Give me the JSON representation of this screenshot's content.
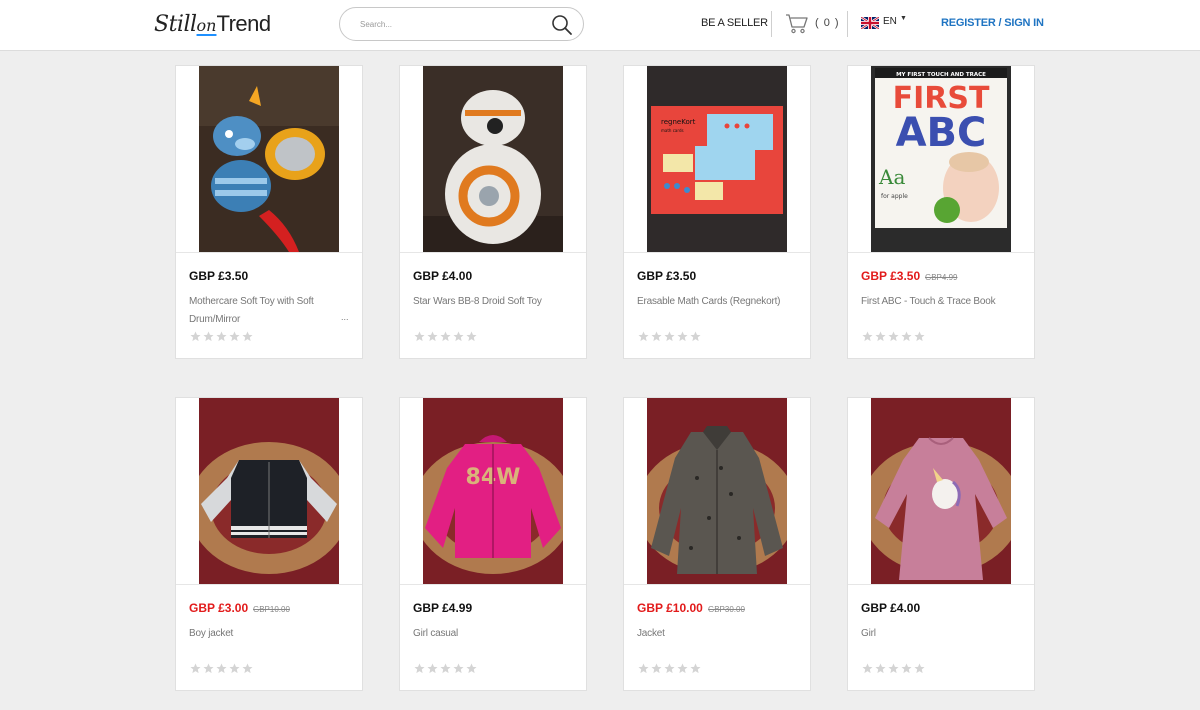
{
  "header": {
    "logo": {
      "still": "Still",
      "on": "on",
      "trend": "Trend"
    },
    "search_placeholder": "Search...",
    "seller_link": "BE A SELLER",
    "cart_count": "( 0 )",
    "language": "EN",
    "register": "REGISTER / SIGN IN"
  },
  "colors": {
    "accent": "#1f74c2",
    "sale_red": "#e21b1b",
    "page_bg": "#eeeeee"
  },
  "products": [
    {
      "price": "GBP £3.50",
      "old_price": "",
      "name": "Mothercare Soft Toy with Soft Drum/Mirror",
      "more": "...",
      "rating": 0
    },
    {
      "price": "GBP £4.00",
      "old_price": "",
      "name": "Star Wars BB-8 Droid Soft Toy",
      "more": "",
      "rating": 0
    },
    {
      "price": "GBP £3.50",
      "old_price": "",
      "name": "Erasable Math Cards (Regnekort)",
      "more": "",
      "rating": 0
    },
    {
      "price": "GBP £3.50",
      "old_price": "GBP4.99",
      "name": "First ABC - Touch & Trace Book",
      "more": "",
      "rating": 0
    },
    {
      "price": "GBP £3.00",
      "old_price": "GBP10.00",
      "name": "Boy jacket",
      "more": "",
      "rating": 0
    },
    {
      "price": "GBP £4.99",
      "old_price": "",
      "name": "Girl casual",
      "more": "",
      "rating": 0
    },
    {
      "price": "GBP £10.00",
      "old_price": "GBP30.00",
      "name": "Jacket",
      "more": "",
      "rating": 0
    },
    {
      "price": "GBP £4.00",
      "old_price": "",
      "name": "Girl",
      "more": "",
      "rating": 0
    }
  ],
  "book_cover": {
    "top_line": "MY FIRST TOUCH AND TRACE",
    "title_1": "FIRST",
    "title_2": "ABC",
    "letters": "Aa",
    "sub": "for apple"
  },
  "math_box": {
    "title": "regneKort",
    "subtitle": "math cards"
  }
}
